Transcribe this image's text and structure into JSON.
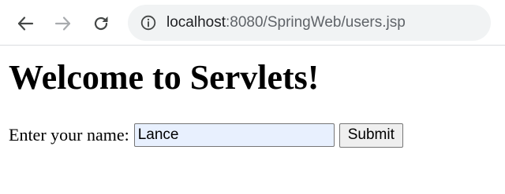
{
  "browser": {
    "url_host": "localhost",
    "url_rest": ":8080/SpringWeb/users.jsp",
    "icons": {
      "back": "back-arrow-icon",
      "forward": "forward-arrow-icon",
      "reload": "reload-icon",
      "site_info": "info-icon"
    }
  },
  "page": {
    "heading": "Welcome to Servlets!",
    "form": {
      "label": "Enter your name:",
      "name_value": "Lance",
      "submit_label": "Submit"
    }
  },
  "colors": {
    "omnibox_background": "#f1f3f4",
    "autofill_background": "#e8f0fe"
  }
}
